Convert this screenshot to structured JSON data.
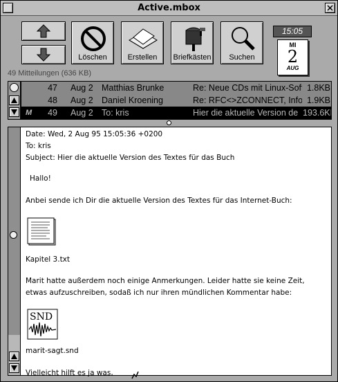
{
  "window": {
    "title": "Active.mbox"
  },
  "toolbar": {
    "delete_label": "Löschen",
    "create_label": "Erstellen",
    "mailboxes_label": "Briefkästen",
    "search_label": "Suchen",
    "clock": "15:05",
    "calendar": {
      "dow": "MI",
      "day": "2",
      "month": "AUG"
    }
  },
  "message_count": "49 Mitteilungen (636 KB)",
  "messages": [
    {
      "flag": "",
      "num": "47",
      "date": "Aug 2",
      "from": "Matthias Brunke",
      "subject": "Re: Neue CDs mit Linux-Softw",
      "size": "1.8KB"
    },
    {
      "flag": "",
      "num": "48",
      "date": "Aug 2",
      "from": "Daniel Kroening",
      "subject": "Re: RFC<>ZCONNECT, Infos",
      "size": "1.9KB"
    },
    {
      "flag": "M",
      "num": "49",
      "date": "Aug 2",
      "from": "To: kris",
      "subject": "Hier die aktuelle Version de",
      "size": "193.6KB"
    }
  ],
  "body": {
    "date": "Date: Wed,  2 Aug 95 15:05:36 +0200",
    "to": "To: kris",
    "subject": "Subject: Hier die aktuelle Version des Textes für das Buch",
    "greeting": "Hallo!",
    "intro": "Anbei sende ich Dir die aktuelle Version des Textes für das Internet-Buch:",
    "attachment1": "Kapitel 3.txt",
    "para1": "Marit hatte außerdem noch einige Anmerkungen. Leider hatte sie keine Zeit,",
    "para2": "etwas aufzuschreiben, sodaß ich nur ihren mündlichen Kommentar habe:",
    "snd_label": "SND",
    "attachment2": "marit-sagt.snd",
    "closing": "Vielleicht hilft es ja was,"
  }
}
